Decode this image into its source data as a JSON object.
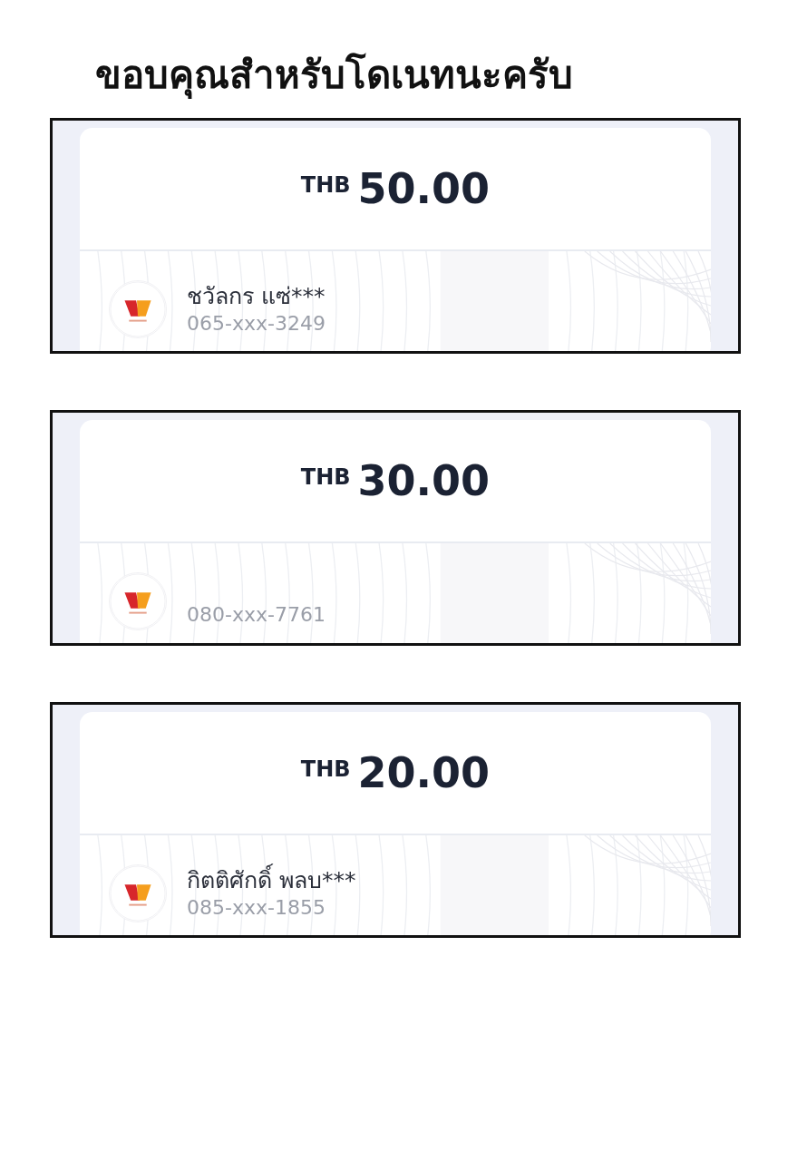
{
  "title": "ขอบคุณสำหรับโดเนทนะครับ",
  "slips": [
    {
      "currency": "THB",
      "amount": "50.00",
      "name": "ชวัลกร แซ่***",
      "phone": "065-xxx-3249"
    },
    {
      "currency": "THB",
      "amount": "30.00",
      "phone": "080-xxx-7761"
    },
    {
      "currency": "THB",
      "amount": "20.00",
      "name": "กิตติศักดิ์ พลบ***",
      "phone": "085-xxx-1855"
    }
  ]
}
